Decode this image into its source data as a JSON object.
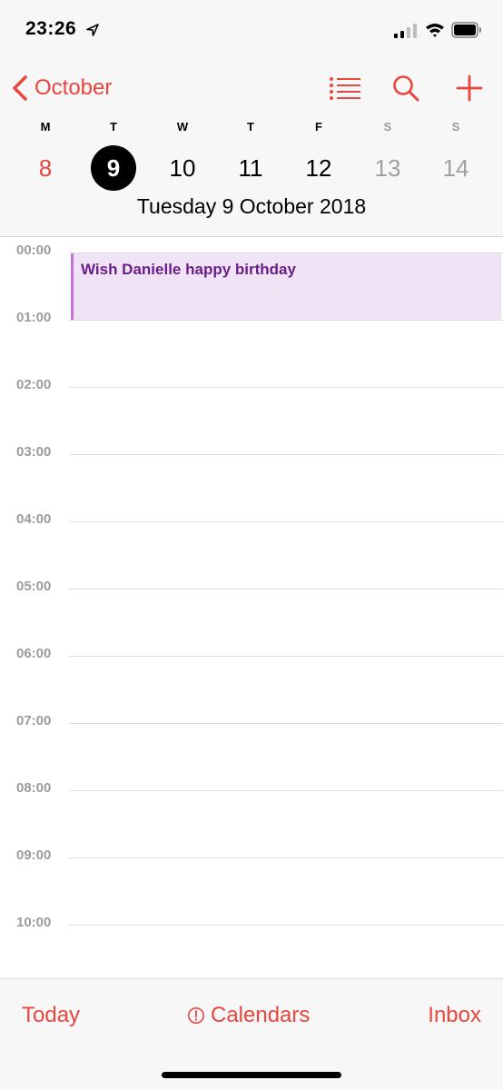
{
  "status_bar": {
    "time": "23:26",
    "icons": [
      "location-arrow-icon",
      "signal-icon",
      "wifi-icon",
      "battery-icon"
    ]
  },
  "nav": {
    "back_label": "October",
    "actions": [
      "list-icon",
      "search-icon",
      "add-icon"
    ]
  },
  "week": {
    "days": [
      {
        "letter": "M",
        "date": "8",
        "state": "past"
      },
      {
        "letter": "T",
        "date": "9",
        "state": "selected"
      },
      {
        "letter": "W",
        "date": "10",
        "state": "normal"
      },
      {
        "letter": "T",
        "date": "11",
        "state": "normal"
      },
      {
        "letter": "F",
        "date": "12",
        "state": "normal"
      },
      {
        "letter": "S",
        "date": "13",
        "state": "weekend"
      },
      {
        "letter": "S",
        "date": "14",
        "state": "weekend"
      }
    ],
    "full_date": "Tuesday  9 October 2018"
  },
  "timeline": {
    "hours": [
      "00:00",
      "01:00",
      "02:00",
      "03:00",
      "04:00",
      "05:00",
      "06:00",
      "07:00",
      "08:00",
      "09:00",
      "10:00"
    ],
    "events": [
      {
        "title": "Wish Danielle happy birthday",
        "start_hour": 0,
        "end_hour": 1
      }
    ]
  },
  "toolbar": {
    "today_label": "Today",
    "calendars_label": "Calendars",
    "inbox_label": "Inbox"
  },
  "colors": {
    "accent": "#e9463e",
    "event_bg": "#f1e3f6",
    "event_border": "#c374d8",
    "event_text": "#6a1f86",
    "hour_text": "#9b9b9b"
  }
}
